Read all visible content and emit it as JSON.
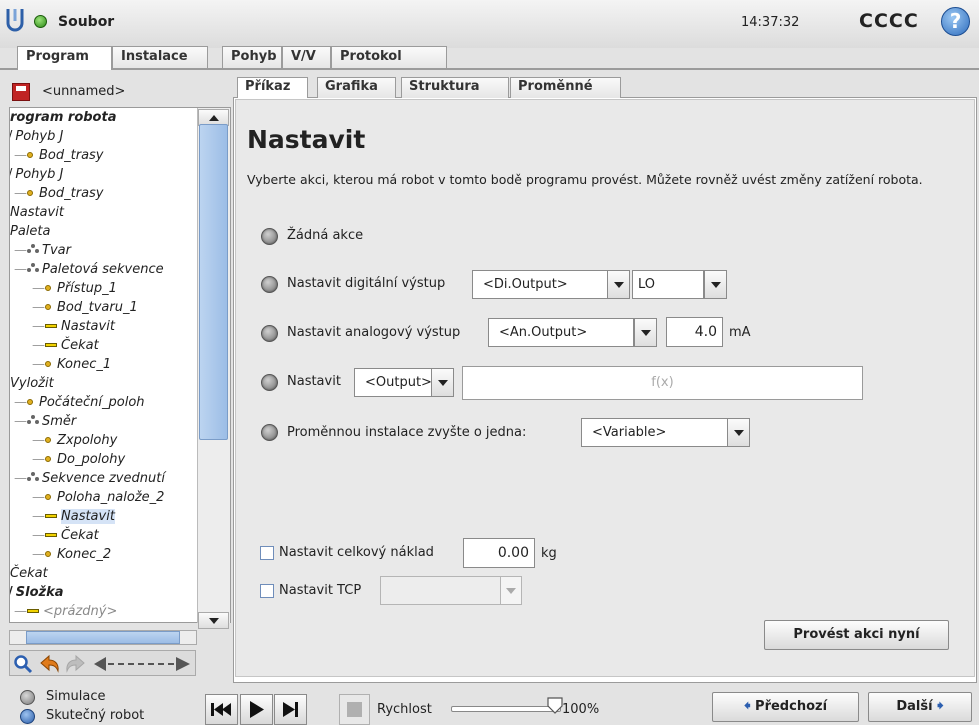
{
  "titlebar": {
    "file_menu": "Soubor",
    "time": "14:37:32",
    "robot_name": "CCCC",
    "help": "?"
  },
  "top_tabs": [
    "Program",
    "Instalace",
    "Pohyb",
    "V/V",
    "Protokol"
  ],
  "left": {
    "program_name": "<unnamed>",
    "tree": [
      {
        "text": "rogram robota",
        "bold": true
      },
      {
        "text": "Pohyb J",
        "prefix": "/"
      },
      {
        "text": "Bod_trasy",
        "icon": "dot",
        "indent": 1
      },
      {
        "text": "Pohyb J",
        "prefix": "/"
      },
      {
        "text": "Bod_trasy",
        "icon": "dot",
        "indent": 1
      },
      {
        "text": "Nastavit"
      },
      {
        "text": "Paleta"
      },
      {
        "text": "Tvar",
        "icon": "pal",
        "indent": 1
      },
      {
        "text": "Paletová sekvence",
        "icon": "pal",
        "indent": 1
      },
      {
        "text": "Přístup_1",
        "icon": "dot",
        "indent": 2
      },
      {
        "text": "Bod_tvaru_1",
        "icon": "dot",
        "indent": 2
      },
      {
        "text": "Nastavit",
        "icon": "dash",
        "indent": 2
      },
      {
        "text": "Čekat",
        "icon": "dash",
        "indent": 2
      },
      {
        "text": "Konec_1",
        "icon": "dot",
        "indent": 2
      },
      {
        "text": "Vyložit"
      },
      {
        "text": "Počáteční_poloh",
        "icon": "dot",
        "indent": 1
      },
      {
        "text": "Směr",
        "icon": "pal",
        "indent": 1
      },
      {
        "text": "Zxpolohy",
        "icon": "dot",
        "indent": 2
      },
      {
        "text": "Do_polohy",
        "icon": "dot",
        "indent": 2
      },
      {
        "text": "Sekvence zvednutí",
        "icon": "pal",
        "indent": 1
      },
      {
        "text": "Poloha_nalože_2",
        "icon": "dot",
        "indent": 2
      },
      {
        "text": "Nastavit",
        "icon": "dash",
        "indent": 2,
        "selected": true
      },
      {
        "text": "Čekat",
        "icon": "dash",
        "indent": 2
      },
      {
        "text": "Konec_2",
        "icon": "dot",
        "indent": 2
      },
      {
        "text": "Čekat"
      },
      {
        "text": "Složka",
        "bold": true,
        "prefix": "/"
      },
      {
        "text": "<prázdný>",
        "icon": "dash",
        "indent": 1,
        "grey": true
      }
    ]
  },
  "sub_tabs": [
    "Příkaz",
    "Grafika",
    "Struktura",
    "Proměnné"
  ],
  "command": {
    "title": "Nastavit",
    "description": "Vyberte akci, kterou má robot v tomto bodě programu provést. Můžete rovněž uvést změny zatížení robota.",
    "option_none": "Žádná akce",
    "option_digital": "Nastavit digitální výstup",
    "digital_output": "<Di.Output>",
    "digital_value": "LO",
    "option_analog": "Nastavit analogový výstup",
    "analog_output": "<An.Output>",
    "analog_value": "4.0",
    "analog_unit": "mA",
    "option_set": "Nastavit",
    "set_output": "<Output>",
    "set_expression_placeholder": "f(x)",
    "option_increment": "Proměnnou instalace zvyšte o jedna:",
    "increment_variable": "<Variable>",
    "payload_label": "Nastavit celkový náklad",
    "payload_value": "0.00",
    "payload_unit": "kg",
    "tcp_label": "Nastavit TCP",
    "execute_button": "Provést akci nyní"
  },
  "bottom": {
    "simulation": "Simulace",
    "real_robot": "Skutečný robot",
    "speed_label": "Rychlost",
    "speed_value": "100%",
    "speed_fraction": 1.0,
    "prev_button": "Předchozí",
    "next_button": "Další"
  }
}
